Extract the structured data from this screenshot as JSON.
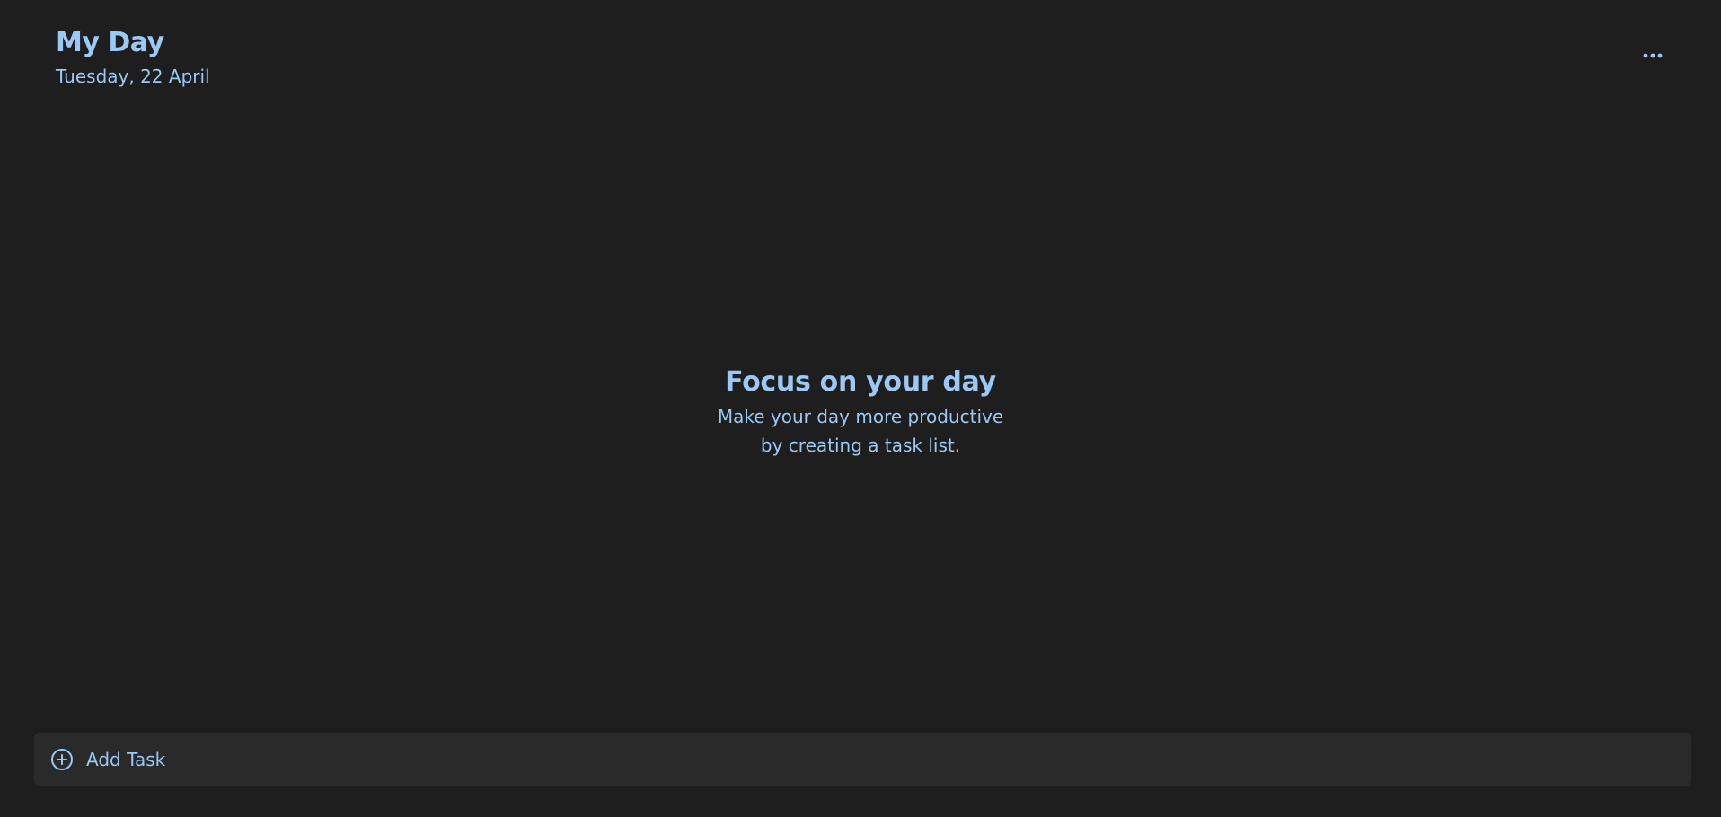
{
  "header": {
    "title": "My Day",
    "date": "Tuesday, 22 April"
  },
  "toolbar": {
    "more_icon": "more-horizontal-icon"
  },
  "empty_state": {
    "title": "Focus on your day",
    "line1": "Make your day more productive",
    "line2": "by creating a task list."
  },
  "add_task": {
    "icon": "plus-circle-icon",
    "label": "Add Task"
  },
  "colors": {
    "background": "#1e1e1e",
    "bar": "#2a2a2a",
    "accent": "#9cc8f5"
  }
}
